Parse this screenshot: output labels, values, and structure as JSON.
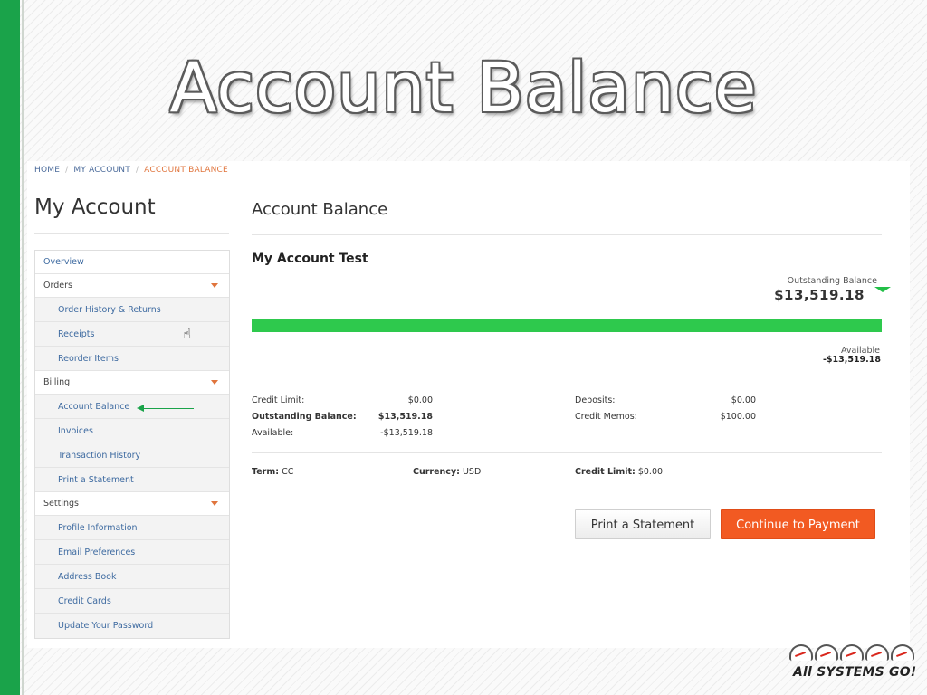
{
  "slide": {
    "title": "Account Balance"
  },
  "breadcrumb": {
    "home": "HOME",
    "my_account": "MY ACCOUNT",
    "current": "ACCOUNT BALANCE",
    "separator": "/"
  },
  "sidebar": {
    "title": "My Account",
    "items": [
      {
        "label": "Overview",
        "type": "top"
      },
      {
        "label": "Orders",
        "type": "section"
      },
      {
        "label": "Order History & Returns",
        "type": "sub"
      },
      {
        "label": "Receipts",
        "type": "sub"
      },
      {
        "label": "Reorder Items",
        "type": "sub"
      },
      {
        "label": "Billing",
        "type": "section"
      },
      {
        "label": "Account Balance",
        "type": "sub"
      },
      {
        "label": "Invoices",
        "type": "sub"
      },
      {
        "label": "Transaction History",
        "type": "sub"
      },
      {
        "label": "Print a Statement",
        "type": "sub"
      },
      {
        "label": "Settings",
        "type": "section"
      },
      {
        "label": "Profile Information",
        "type": "sub"
      },
      {
        "label": "Email Preferences",
        "type": "sub"
      },
      {
        "label": "Address Book",
        "type": "sub"
      },
      {
        "label": "Credit Cards",
        "type": "sub"
      },
      {
        "label": "Update Your Password",
        "type": "sub"
      }
    ]
  },
  "main": {
    "title": "Account Balance",
    "account_name": "My Account Test",
    "outstanding": {
      "label": "Outstanding Balance",
      "value": "$13,519.18"
    },
    "available": {
      "label": "Available",
      "value": "-$13,519.18"
    },
    "progress_fraction": 1.0,
    "stats_left": [
      {
        "label": "Credit Limit:",
        "value": "$0.00",
        "bold": false
      },
      {
        "label": "Outstanding Balance:",
        "value": "$13,519.18",
        "bold": true
      },
      {
        "label": "Available:",
        "value": "-$13,519.18",
        "bold": false
      }
    ],
    "stats_right": [
      {
        "label": "Deposits:",
        "value": "$0.00"
      },
      {
        "label": "Credit Memos:",
        "value": "$100.00"
      }
    ],
    "terms": {
      "term_label": "Term:",
      "term_value": "CC",
      "currency_label": "Currency:",
      "currency_value": "USD",
      "credit_label": "Credit Limit:",
      "credit_value": "$0.00"
    },
    "buttons": {
      "print": "Print a Statement",
      "pay": "Continue to Payment"
    }
  },
  "colors": {
    "accent_green": "#2ec94d",
    "accent_orange": "#f25a22",
    "link_blue": "#3d6aa0"
  },
  "logo": {
    "text": "All SYSTEMS GO!"
  }
}
